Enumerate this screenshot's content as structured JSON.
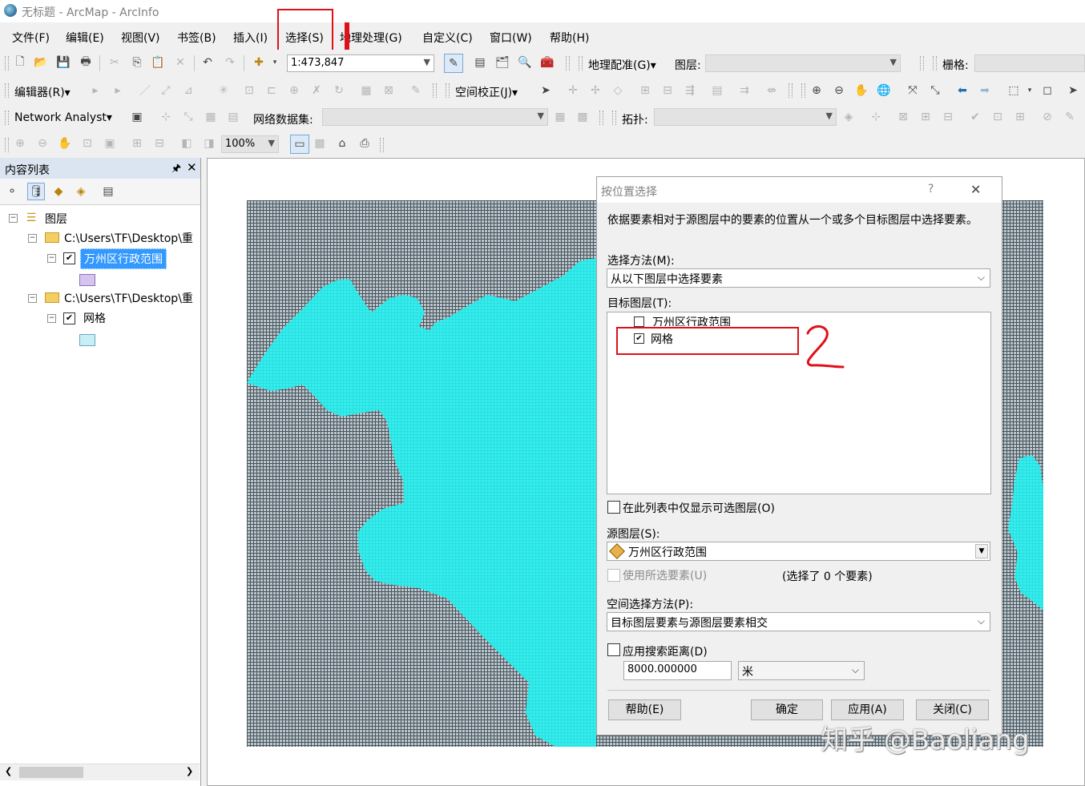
{
  "window": {
    "title": "无标题 - ArcMap - ArcInfo"
  },
  "menu": [
    "文件(F)",
    "编辑(E)",
    "视图(V)",
    "书签(B)",
    "插入(I)",
    "选择(S)",
    "地理处理(G)",
    "自定义(C)",
    "窗口(W)",
    "帮助(H)"
  ],
  "toolbar1": {
    "scale": "1:473,847",
    "georef_label": "地理配准(G)▾",
    "layer_label": "图层:",
    "raster_label": "栅格:"
  },
  "toolbar2": {
    "editor_label": "编辑器(R)▾",
    "spatial_adjust_label": "空间校正(J)▾"
  },
  "toolbar3": {
    "network_label": "Network Analyst▾",
    "network_dataset_label": "网络数据集:",
    "topology_label": "拓扑:"
  },
  "toolbar4": {
    "zoom": "100%"
  },
  "toc": {
    "title": "内容列表",
    "root_label": "图层",
    "path1": "C:\\Users\\TF\\Desktop\\重",
    "layer1": "万州区行政范围",
    "path2": "C:\\Users\\TF\\Desktop\\重",
    "layer2": "网格"
  },
  "colors": {
    "region_fill": "#2ee8e8",
    "highlight": "#e0101a",
    "layer1_swatch": "#d7c3ef",
    "layer2_swatch": "#c9eef6"
  },
  "dialog": {
    "title": "按位置选择",
    "help_glyph": "?",
    "close_glyph": "✕",
    "description": "依据要素相对于源图层中的要素的位置从一个或多个目标图层中选择要素。",
    "method_label": "选择方法(M):",
    "method_value": "从以下图层中选择要素",
    "target_label": "目标图层(T):",
    "targets": [
      {
        "name": "万州区行政范围",
        "checked": false
      },
      {
        "name": "网格",
        "checked": true
      }
    ],
    "only_selectable_label": "在此列表中仅显示可选图层(O)",
    "source_label": "源图层(S):",
    "source_value": "万州区行政范围",
    "use_selected_label": "使用所选要素(U)",
    "selected_count": "(选择了 0 个要素)",
    "spatial_method_label": "空间选择方法(P):",
    "spatial_method_value": "目标图层要素与源图层要素相交",
    "search_distance_label": "应用搜索距离(D)",
    "distance_value": "8000.000000",
    "unit_value": "米",
    "buttons": {
      "help": "帮助(E)",
      "ok": "确定",
      "apply": "应用(A)",
      "close": "关闭(C)"
    }
  },
  "annotation": {
    "step2": "2"
  },
  "watermark": "知乎 @Baoliang"
}
